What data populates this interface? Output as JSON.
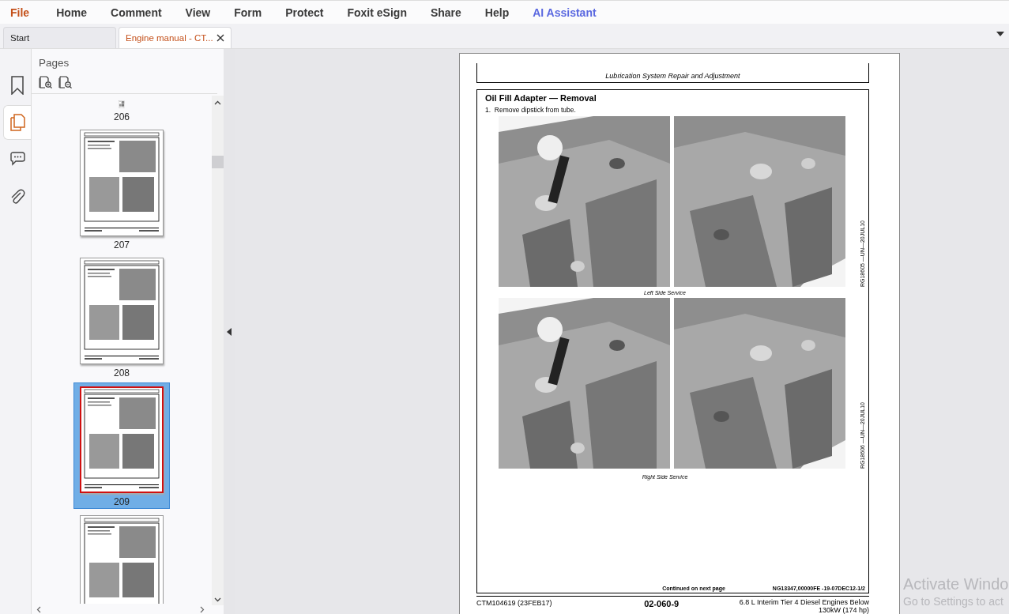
{
  "menu": [
    {
      "label": "File",
      "kind": "file"
    },
    {
      "label": "Home",
      "kind": "plain"
    },
    {
      "label": "Comment",
      "kind": "plain"
    },
    {
      "label": "View",
      "kind": "plain"
    },
    {
      "label": "Form",
      "kind": "plain"
    },
    {
      "label": "Protect",
      "kind": "plain"
    },
    {
      "label": "Foxit eSign",
      "kind": "plain"
    },
    {
      "label": "Share",
      "kind": "plain"
    },
    {
      "label": "Help",
      "kind": "plain"
    },
    {
      "label": "AI Assistant",
      "kind": "ai"
    }
  ],
  "tabs": [
    {
      "label": "Start",
      "selected": false,
      "closable": false
    },
    {
      "label": "Engine manual - CT...",
      "selected": true,
      "closable": true
    }
  ],
  "rail": [
    {
      "kind": "bookmark",
      "selected": false
    },
    {
      "kind": "pages",
      "selected": true
    },
    {
      "kind": "comment",
      "selected": false
    },
    {
      "kind": "attachment",
      "selected": false
    }
  ],
  "panel": {
    "title": "Pages",
    "thumbnails": [
      {
        "number": "206",
        "selected": false,
        "kind": "clipped_top"
      },
      {
        "number": "207",
        "selected": false,
        "kind": "full"
      },
      {
        "number": "208",
        "selected": false,
        "kind": "full"
      },
      {
        "number": "209",
        "selected": true,
        "kind": "full"
      },
      {
        "selected": false,
        "kind": "clipped_bottom"
      }
    ]
  },
  "document": {
    "running_head": "Lubrication System Repair and Adjustment",
    "section_title": "Oil Fill Adapter — Removal",
    "step": "1.  Remove dipstick from tube.",
    "figures": [
      {
        "caption": "Left Side Service",
        "code": "RG18605 —UN—20JUL10"
      },
      {
        "caption": "Right Side Service",
        "code": "RG18606 —UN—20JUL10"
      }
    ],
    "continued": "Continued on next page",
    "ref_code": "NG13347,00000FE -19-07DEC12-1/2",
    "footer": {
      "left": "CTM104619 (23FEB17)",
      "center": "02-060-9",
      "right_line1": "6.8 L Interim Tier 4 Diesel Engines Below",
      "right_line2": "130kW (174 hp)"
    }
  },
  "os_notice": {
    "title": "Activate Windo",
    "subtitle": "Go to Settings to act"
  }
}
